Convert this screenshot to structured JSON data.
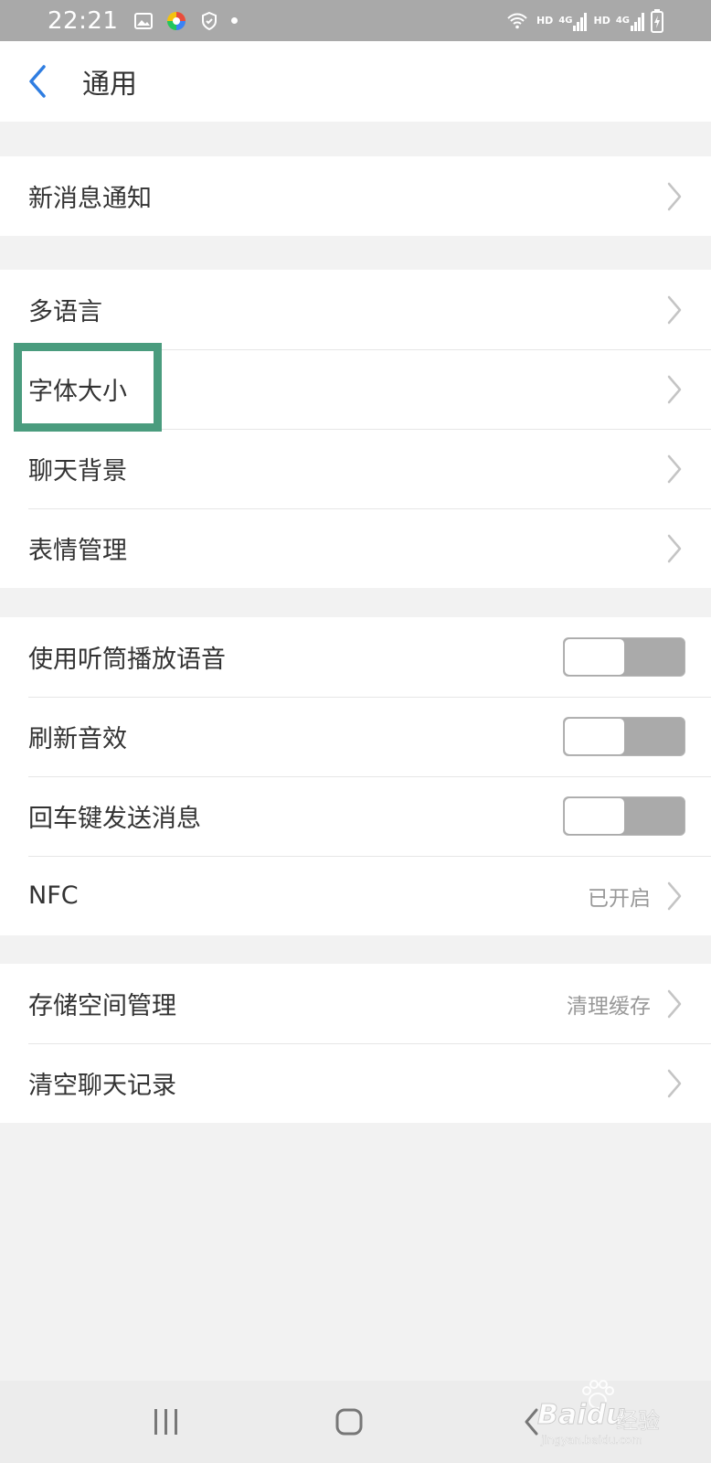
{
  "status_bar": {
    "time": "22:21",
    "hd1": "HD",
    "net1": "4G",
    "hd2": "HD",
    "net2": "4G"
  },
  "header": {
    "title": "通用"
  },
  "groups": [
    {
      "items": [
        {
          "label": "新消息通知"
        }
      ]
    },
    {
      "items": [
        {
          "label": "多语言"
        },
        {
          "label": "字体大小"
        },
        {
          "label": "聊天背景"
        },
        {
          "label": "表情管理"
        }
      ]
    },
    {
      "items": [
        {
          "label": "使用听筒播放语音",
          "toggle": "off"
        },
        {
          "label": "刷新音效",
          "toggle": "off"
        },
        {
          "label": "回车键发送消息",
          "toggle": "off"
        },
        {
          "label": "NFC",
          "value": "已开启"
        }
      ]
    },
    {
      "items": [
        {
          "label": "存储空间管理",
          "value": "清理缓存"
        },
        {
          "label": "清空聊天记录"
        }
      ]
    }
  ],
  "highlight_color": "#4a9c7e",
  "watermark": {
    "brand": "Bai",
    "brand2": "du",
    "suffix": "经验",
    "url": "jingyan.baidu.com"
  },
  "icons": [
    "back-arrow-icon",
    "chevron-right-icon",
    "recent-apps-icon",
    "home-icon",
    "nav-back-icon"
  ]
}
